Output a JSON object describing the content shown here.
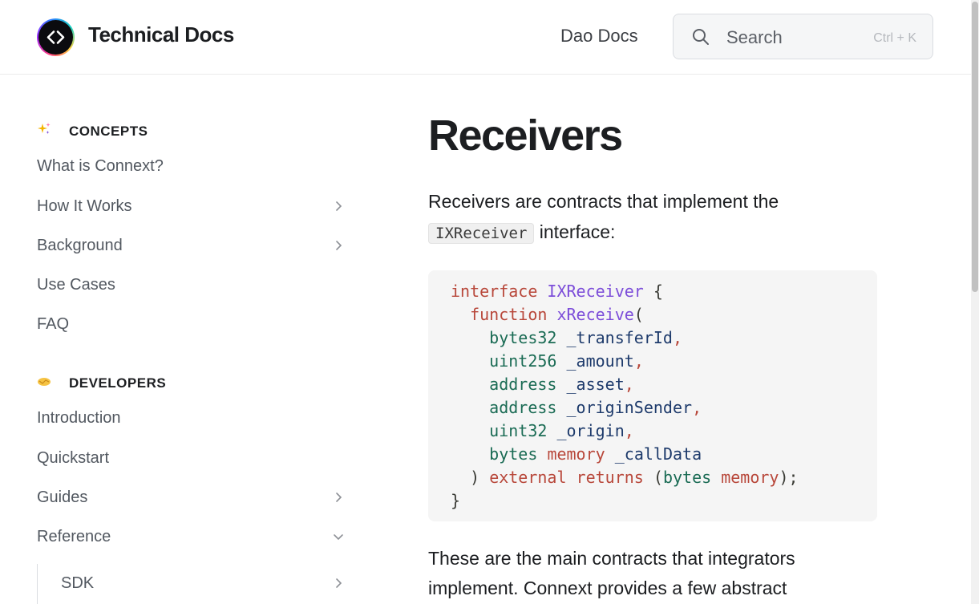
{
  "header": {
    "site_title": "Technical Docs",
    "nav_link": "Dao Docs",
    "search_placeholder": "Search",
    "search_shortcut": "Ctrl + K"
  },
  "sidebar": {
    "categories": [
      {
        "icon": "sparkles-icon",
        "label": "CONCEPTS"
      },
      {
        "icon": "handshake-icon",
        "label": "DEVELOPERS"
      }
    ],
    "items": [
      {
        "label": "What is Connext?",
        "chevron": "none"
      },
      {
        "label": "How It Works",
        "chevron": "right"
      },
      {
        "label": "Background",
        "chevron": "right"
      },
      {
        "label": "Use Cases",
        "chevron": "none"
      },
      {
        "label": "FAQ",
        "chevron": "none"
      },
      {
        "label": "Introduction",
        "chevron": "none"
      },
      {
        "label": "Quickstart",
        "chevron": "none"
      },
      {
        "label": "Guides",
        "chevron": "right"
      },
      {
        "label": "Reference",
        "chevron": "down"
      },
      {
        "label": "SDK",
        "chevron": "right"
      }
    ]
  },
  "main": {
    "title": "Receivers",
    "intro_before": "Receivers are contracts that implement the",
    "intro_code": "IXReceiver",
    "intro_after": "interface:",
    "code": {
      "l1_kw": "interface",
      "l1_name": "IXReceiver",
      "l1_brace": "{",
      "l2_kw": "function",
      "l2_name": "xReceive",
      "l2_paren": "(",
      "p1_type": "bytes32",
      "p1_name": "_transferId",
      "p2_type": "uint256",
      "p2_name": "_amount",
      "p3_type": "address",
      "p3_name": "_asset",
      "p4_type": "address",
      "p4_name": "_originSender",
      "p5_type": "uint32",
      "p5_name": "_origin",
      "p6_type": "bytes",
      "p6_mod": "memory",
      "p6_name": "_callData",
      "comma": ",",
      "close_paren": ")",
      "external_kw": "external",
      "returns_kw": "returns",
      "ret_open": "(",
      "ret_type": "bytes",
      "ret_mod": "memory",
      "ret_close": ");",
      "last_brace": "}"
    },
    "para2": "These are the main contracts that integrators implement. Connext provides a few abstract"
  },
  "colors": {
    "keyword": "#b8473a",
    "function": "#7c4dd9",
    "type": "#1a6b54",
    "variable": "#1d3a6b"
  }
}
